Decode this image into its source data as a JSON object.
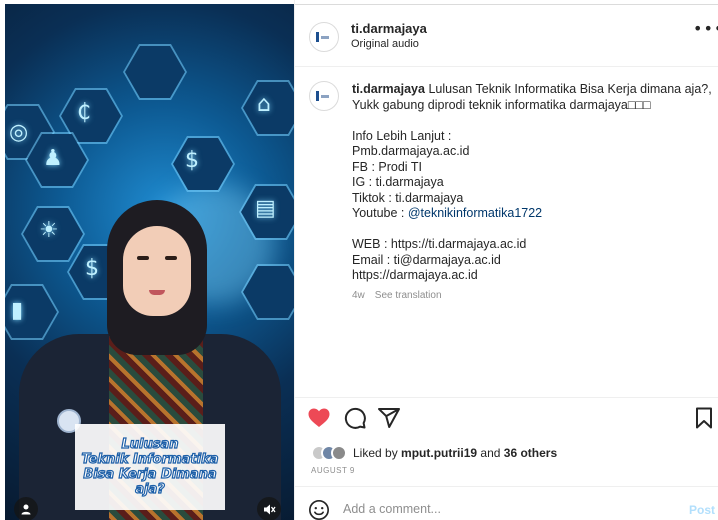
{
  "colors": {
    "like_red": "#ed4956",
    "link_blue": "#00376b",
    "post_disabled": "#b2dffc",
    "muted": "#8e8e8e"
  },
  "video": {
    "overlay_text": "Lulusan\nTeknik Informatika\nBisa Kerja Dimana\naja?",
    "icons": [
      "target-icon",
      "dollar-chart-icon",
      "person-icon",
      "dollar-search-icon",
      "store-icon",
      "lightbulb-icon",
      "dollar-icon",
      "webpage-icon",
      "chart-icon"
    ],
    "profile_icon": "user-icon",
    "mute_icon": "muted-speaker-icon"
  },
  "header": {
    "username": "ti.darmajaya",
    "audio": "Original audio",
    "more_icon": "more-options-icon"
  },
  "caption": {
    "username": "ti.darmajaya",
    "lines": [
      "Lulusan Teknik Informatika Bisa Kerja dimana aja?,",
      "Yukk gabung diprodi teknik informatika darmajaya□□□",
      "",
      "Info Lebih Lanjut :",
      "Pmb.darmajaya.ac.id",
      "FB : Prodi TI",
      "IG : ti.darmajaya",
      "Tiktok : ti.darmajaya",
      "Youtube : ",
      "",
      "WEB : https://ti.darmajaya.ac.id",
      "Email : ti@darmajaya.ac.id",
      "https://darmajaya.ac.id"
    ],
    "youtube_tag": "@teknikinformatika1722"
  },
  "meta": {
    "age": "4w",
    "see_translation": "See translation"
  },
  "actions": {
    "like_icon": "heart-icon",
    "comment_icon": "comment-icon",
    "share_icon": "share-icon",
    "save_icon": "bookmark-icon"
  },
  "likes": {
    "prefix": "Liked by",
    "user": "mput.putrii19",
    "and": "and",
    "others": "36 others"
  },
  "date": "AUGUST 9",
  "comment": {
    "placeholder": "Add a comment...",
    "post_label": "Post",
    "emoji_icon": "emoji-icon"
  }
}
